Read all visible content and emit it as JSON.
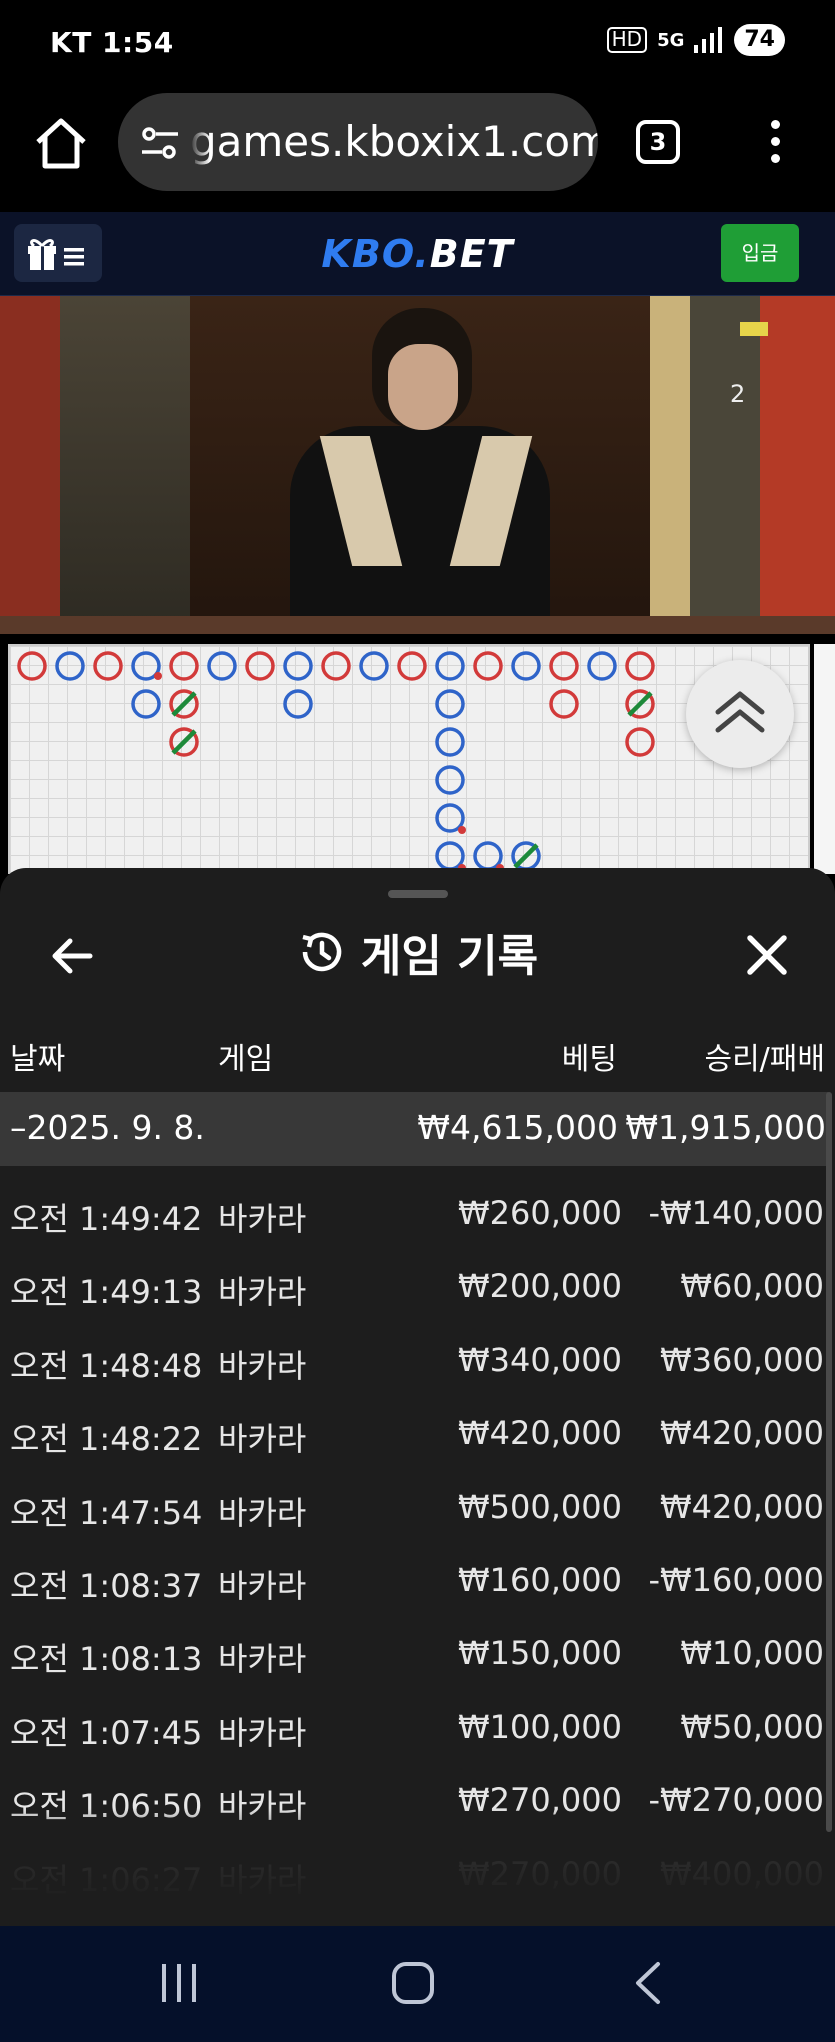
{
  "status_bar": {
    "carrier": "KT",
    "time": "1:54",
    "hd_icon": "HD",
    "network": "5G",
    "battery": "74"
  },
  "browser": {
    "url": "games.kboxix1.com",
    "tab_count": "3"
  },
  "site": {
    "logo_kbo": "KBO.",
    "logo_bet": "BET",
    "deposit_label": "입금"
  },
  "video": {
    "overlay_number": "2"
  },
  "history": {
    "title": "게임 기록",
    "columns": {
      "date": "날짜",
      "game": "게임",
      "bet": "베팅",
      "win_loss": "승리/패배"
    },
    "day": {
      "date": "–2025. 9. 8.",
      "bet_total": "₩4,615,000",
      "win_loss_total": "₩1,915,000"
    },
    "rows": [
      {
        "time": "오전 1:49:42",
        "game": "바카라",
        "bet": "₩260,000",
        "result": "-₩140,000"
      },
      {
        "time": "오전 1:49:13",
        "game": "바카라",
        "bet": "₩200,000",
        "result": "₩60,000"
      },
      {
        "time": "오전 1:48:48",
        "game": "바카라",
        "bet": "₩340,000",
        "result": "₩360,000"
      },
      {
        "time": "오전 1:48:22",
        "game": "바카라",
        "bet": "₩420,000",
        "result": "₩420,000"
      },
      {
        "time": "오전 1:47:54",
        "game": "바카라",
        "bet": "₩500,000",
        "result": "₩420,000"
      },
      {
        "time": "오전 1:08:37",
        "game": "바카라",
        "bet": "₩160,000",
        "result": "-₩160,000"
      },
      {
        "time": "오전 1:08:13",
        "game": "바카라",
        "bet": "₩150,000",
        "result": "₩10,000"
      },
      {
        "time": "오전 1:07:45",
        "game": "바카라",
        "bet": "₩100,000",
        "result": "₩50,000"
      },
      {
        "time": "오전 1:06:50",
        "game": "바카라",
        "bet": "₩270,000",
        "result": "-₩270,000"
      },
      {
        "time": "오전 1:06:27",
        "game": "바카라",
        "bet": "₩270,000",
        "result": "₩400,000"
      }
    ]
  },
  "colors": {
    "banker_red": "#d23a3a",
    "player_blue": "#2f64c9",
    "tie_green": "#1d8a3a",
    "deposit_green": "#1f9e36",
    "logo_blue": "#2f7cf0"
  },
  "icons": {
    "home": "home-icon",
    "tune": "tune-icon",
    "gift": "gift-icon",
    "menu": "menu-icon",
    "scroll_top": "double-chevron-up-icon",
    "back": "arrow-left-icon",
    "history": "history-icon",
    "close": "close-icon"
  }
}
